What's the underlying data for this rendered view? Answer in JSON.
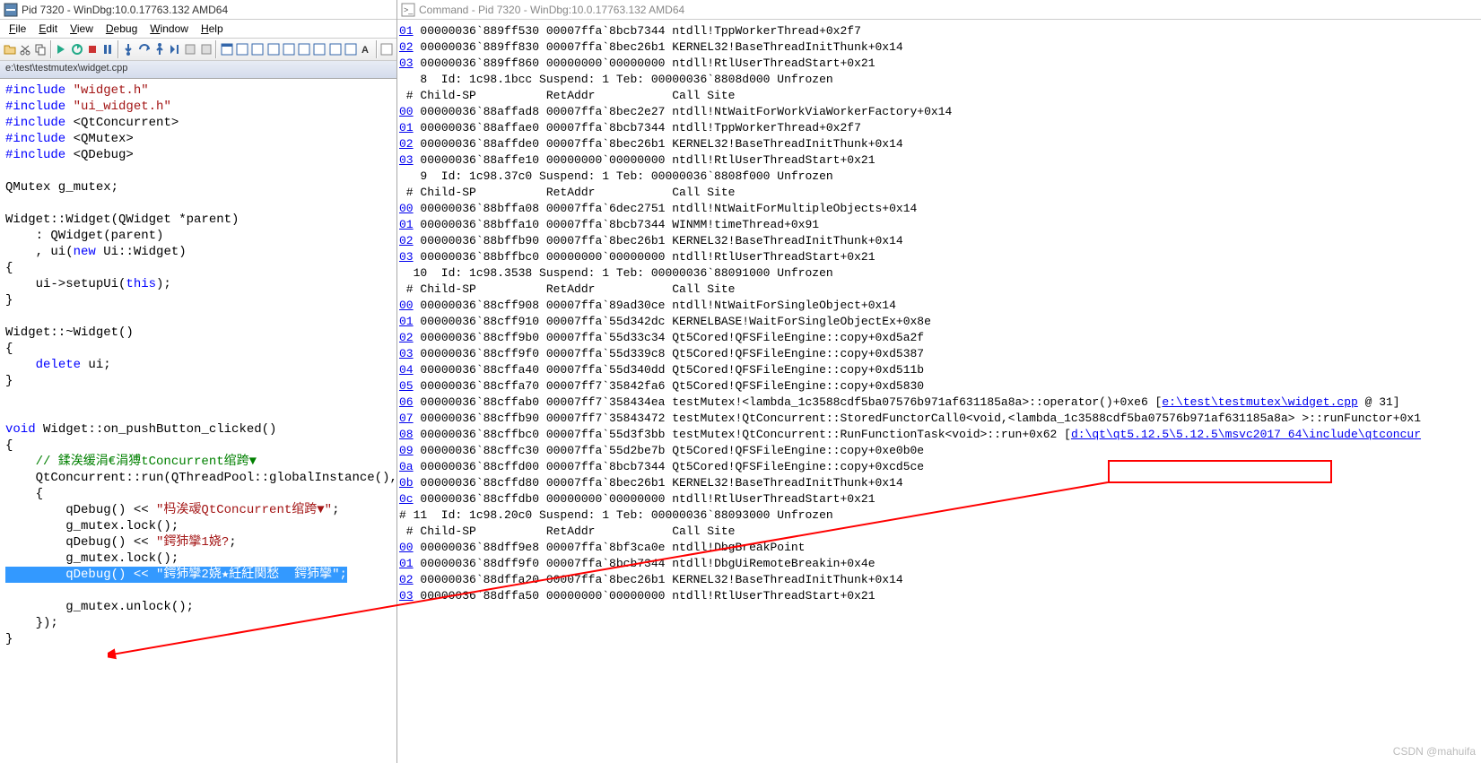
{
  "left": {
    "title": "Pid 7320 - WinDbg:10.0.17763.132 AMD64",
    "menu": [
      "File",
      "Edit",
      "View",
      "Debug",
      "Window",
      "Help"
    ],
    "path": "e:\\test\\testmutex\\widget.cpp",
    "code": {
      "l1a": "#include",
      "l1b": "\"widget.h\"",
      "l2a": "#include",
      "l2b": "\"ui_widget.h\"",
      "l3a": "#include",
      "l3b": "<QtConcurrent>",
      "l4a": "#include",
      "l4b": "<QMutex>",
      "l5a": "#include",
      "l5b": "<QDebug>",
      "l7": "QMutex g_mutex;",
      "l9": "Widget::Widget(QWidget *parent)",
      "l10": "    : QWidget(parent)",
      "l11a": "    , ui(",
      "l11b": "new",
      "l11c": " Ui::Widget)",
      "l12": "{",
      "l13a": "    ui->setupUi(",
      "l13b": "this",
      "l13c": ");",
      "l14": "}",
      "l16": "Widget::~Widget()",
      "l17": "{",
      "l18a": "    ",
      "l18b": "delete",
      "l18c": " ui;",
      "l19": "}",
      "l22a": "void",
      "l22b": " Widget::on_pushButton_clicked()",
      "l23": "{",
      "l24": "    // 鍒涘缓涓€涓猼tConcurrent绾跨▼",
      "l25": "    QtConcurrent::run(QThreadPool::globalInstance(), [&]()",
      "l26": "    {",
      "l27a": "        qDebug() << ",
      "l27b": "\"杩涘叆QtConcurrent绾跨▼\"",
      "l27c": ";",
      "l28": "        g_mutex.lock();",
      "l29a": "        qDebug() << ",
      "l29b": "\"鍔犻攣1娆?",
      "l29c": ";",
      "l30": "        g_mutex.lock();",
      "l31a": "        qDebug() << ",
      "l31b": "\"鍔犻攣2娆★紝紝関愁  鍔犻攣\"",
      "l31c": ";",
      "l33": "        g_mutex.unlock();",
      "l34": "    });",
      "l35": "}"
    }
  },
  "right": {
    "title": "Command - Pid 7320 - WinDbg:10.0.17763.132 AMD64",
    "lines": [
      {
        "link": "01",
        "txt": " 00000036`889ff530 00007ffa`8bcb7344 ntdll!TppWorkerThread+0x2f7"
      },
      {
        "link": "02",
        "txt": " 00000036`889ff830 00007ffa`8bec26b1 KERNEL32!BaseThreadInitThunk+0x14"
      },
      {
        "link": "03",
        "txt": " 00000036`889ff860 00000000`00000000 ntdll!RtlUserThreadStart+0x21"
      },
      {
        "txt": ""
      },
      {
        "txt": "   8  Id: 1c98.1bcc Suspend: 1 Teb: 00000036`8808d000 Unfrozen"
      },
      {
        "txt": " # Child-SP          RetAddr           Call Site"
      },
      {
        "link": "00",
        "txt": " 00000036`88affad8 00007ffa`8bec2e27 ntdll!NtWaitForWorkViaWorkerFactory+0x14"
      },
      {
        "link": "01",
        "txt": " 00000036`88affae0 00007ffa`8bcb7344 ntdll!TppWorkerThread+0x2f7"
      },
      {
        "link": "02",
        "txt": " 00000036`88affde0 00007ffa`8bec26b1 KERNEL32!BaseThreadInitThunk+0x14"
      },
      {
        "link": "03",
        "txt": " 00000036`88affe10 00000000`00000000 ntdll!RtlUserThreadStart+0x21"
      },
      {
        "txt": ""
      },
      {
        "txt": "   9  Id: 1c98.37c0 Suspend: 1 Teb: 00000036`8808f000 Unfrozen"
      },
      {
        "txt": " # Child-SP          RetAddr           Call Site"
      },
      {
        "link": "00",
        "txt": " 00000036`88bffa08 00007ffa`6dec2751 ntdll!NtWaitForMultipleObjects+0x14"
      },
      {
        "link": "01",
        "txt": " 00000036`88bffa10 00007ffa`8bcb7344 WINMM!timeThread+0x91"
      },
      {
        "link": "02",
        "txt": " 00000036`88bffb90 00007ffa`8bec26b1 KERNEL32!BaseThreadInitThunk+0x14"
      },
      {
        "link": "03",
        "txt": " 00000036`88bffbc0 00000000`00000000 ntdll!RtlUserThreadStart+0x21"
      },
      {
        "txt": ""
      },
      {
        "txt": "  10  Id: 1c98.3538 Suspend: 1 Teb: 00000036`88091000 Unfrozen"
      },
      {
        "txt": " # Child-SP          RetAddr           Call Site"
      },
      {
        "link": "00",
        "txt": " 00000036`88cff908 00007ffa`89ad30ce ntdll!NtWaitForSingleObject+0x14"
      },
      {
        "link": "01",
        "txt": " 00000036`88cff910 00007ffa`55d342dc KERNELBASE!WaitForSingleObjectEx+0x8e"
      },
      {
        "link": "02",
        "txt": " 00000036`88cff9b0 00007ffa`55d33c34 Qt5Cored!QFSFileEngine::copy+0xd5a2f"
      },
      {
        "link": "03",
        "txt": " 00000036`88cff9f0 00007ffa`55d339c8 Qt5Cored!QFSFileEngine::copy+0xd5387"
      },
      {
        "link": "04",
        "txt": " 00000036`88cffa40 00007ffa`55d340dd Qt5Cored!QFSFileEngine::copy+0xd511b"
      },
      {
        "link": "05",
        "txt": " 00000036`88cffa70 00007ff7`35842fa6 Qt5Cored!QFSFileEngine::copy+0xd5830"
      },
      {
        "link": "06",
        "txt": " 00000036`88cffab0 00007ff7`358434ea testMutex!<lambda_1c3588cdf5ba07576b971af631185a8a>::operator()+0xe6 [",
        "link2": "e:\\test\\testmutex\\widget.cpp",
        "txt2": " @ 31]"
      },
      {
        "link": "07",
        "txt": " 00000036`88cffb90 00007ff7`35843472 testMutex!QtConcurrent::StoredFunctorCall0<void,<lambda_1c3588cdf5ba07576b971af631185a8a> >::runFunctor+0x1"
      },
      {
        "link": "08",
        "txt": " 00000036`88cffbc0 00007ffa`55d3f3bb testMutex!QtConcurrent::RunFunctionTask<void>::run+0x62 [",
        "link2": "d:\\qt\\qt5.12.5\\5.12.5\\msvc2017_64\\include\\qtconcur"
      },
      {
        "link": "09",
        "txt": " 00000036`88cffc30 00007ffa`55d2be7b Qt5Cored!QFSFileEngine::copy+0xe0b0e"
      },
      {
        "link": "0a",
        "txt": " 00000036`88cffd00 00007ffa`8bcb7344 Qt5Cored!QFSFileEngine::copy+0xcd5ce"
      },
      {
        "link": "0b",
        "txt": " 00000036`88cffd80 00007ffa`8bec26b1 KERNEL32!BaseThreadInitThunk+0x14"
      },
      {
        "link": "0c",
        "txt": " 00000036`88cffdb0 00000000`00000000 ntdll!RtlUserThreadStart+0x21"
      },
      {
        "txt": ""
      },
      {
        "txt": "# 11  Id: 1c98.20c0 Suspend: 1 Teb: 00000036`88093000 Unfrozen"
      },
      {
        "txt": " # Child-SP          RetAddr           Call Site"
      },
      {
        "link": "00",
        "txt": " 00000036`88dff9e8 00007ffa`8bf3ca0e ntdll!DbgBreakPoint"
      },
      {
        "link": "01",
        "txt": " 00000036`88dff9f0 00007ffa`8bcb7344 ntdll!DbgUiRemoteBreakin+0x4e"
      },
      {
        "link": "02",
        "txt": " 00000036`88dffa20 00007ffa`8bec26b1 KERNEL32!BaseThreadInitThunk+0x14"
      },
      {
        "link": "03",
        "txt": " 00000036`88dffa50 00000000`00000000 ntdll!RtlUserThreadStart+0x21"
      }
    ]
  },
  "watermark": "CSDN @mahuifa"
}
